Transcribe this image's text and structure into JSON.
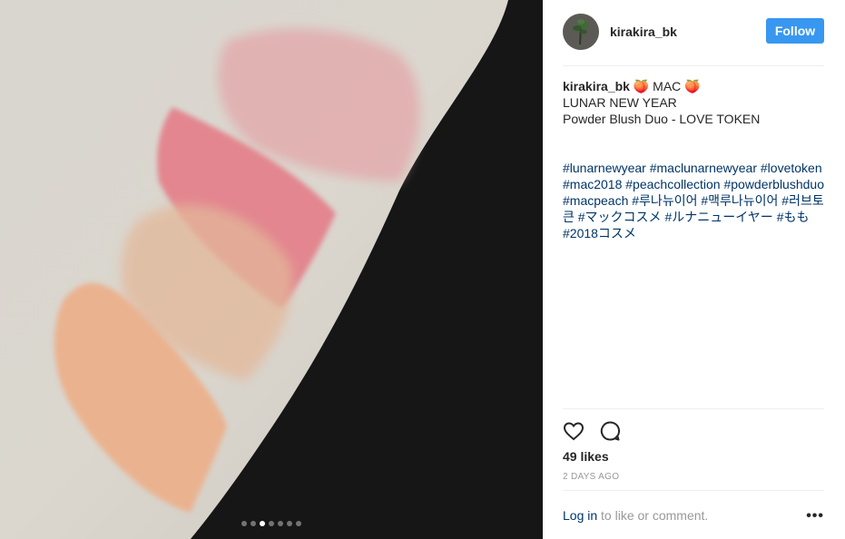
{
  "post": {
    "username": "kirakira_bk",
    "follow_label": "Follow",
    "caption_user": "kirakira_bk",
    "caption_line1_rest": " 🍑 MAC 🍑",
    "caption_line2": "LUNAR NEW YEAR",
    "caption_line3": "Powder Blush Duo - LOVE TOKEN",
    "hashtags_text": "#lunarnewyear #maclunarnewyear #lovetoken #mac2018 #peachcollection #powderblushduo #macpeach #루나뉴이어 #맥루나뉴이어 #러브토큰 #マックコスメ #ルナニューイヤー #もも #2018コスメ",
    "likes": "49 likes",
    "time_ago": "2 DAYS AGO",
    "login_link": "Log in",
    "login_rest": " to like or comment.",
    "more_label": "•••"
  },
  "carousel": {
    "count": 7,
    "active_index": 2
  },
  "colors": {
    "follow_bg": "#3897f0",
    "hashtag": "#003569",
    "muted": "#999999"
  },
  "icons": [
    "heart-icon",
    "comment-icon",
    "more-options-icon"
  ]
}
